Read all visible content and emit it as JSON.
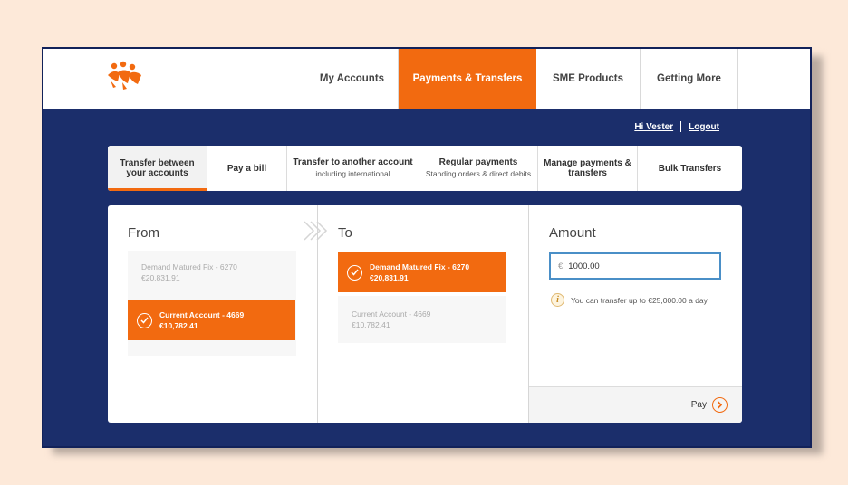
{
  "nav": {
    "items": [
      {
        "label": "My Accounts",
        "active": false
      },
      {
        "label": "Payments & Transfers",
        "active": true
      },
      {
        "label": "SME Products",
        "active": false
      },
      {
        "label": "Getting More",
        "active": false
      }
    ]
  },
  "user": {
    "greeting": "Hi Vester",
    "logout": "Logout"
  },
  "tabs": [
    {
      "title": "Transfer between your accounts",
      "subtitle": "",
      "active": true
    },
    {
      "title": "Pay a bill",
      "subtitle": "",
      "active": false
    },
    {
      "title": "Transfer to another account",
      "subtitle": "including international",
      "active": false
    },
    {
      "title": "Regular payments",
      "subtitle": "Standing orders & direct debits",
      "active": false
    },
    {
      "title": "Manage payments & transfers",
      "subtitle": "",
      "active": false
    },
    {
      "title": "Bulk Transfers",
      "subtitle": "",
      "active": false
    }
  ],
  "from": {
    "title": "From",
    "accounts": [
      {
        "name": "Demand Matured Fix - 6270",
        "balance": "€20,831.91",
        "selected": false
      },
      {
        "name": "Current Account - 4669",
        "balance": "€10,782.41",
        "selected": true
      }
    ]
  },
  "to": {
    "title": "To",
    "accounts": [
      {
        "name": "Demand Matured Fix - 6270",
        "balance": "€20,831.91",
        "selected": true
      },
      {
        "name": "Current Account - 4669",
        "balance": "€10,782.41",
        "selected": false
      }
    ]
  },
  "amount": {
    "title": "Amount",
    "currency": "€",
    "value": "1000.00",
    "info_text": "You can transfer up to €25,000.00 a day"
  },
  "pay_label": "Pay",
  "colors": {
    "accent": "#f26a10",
    "navy": "#1b2e6b",
    "input_border": "#4a8fc7"
  },
  "icons": [
    "logo-icon",
    "check-circle-icon",
    "chevron-right-icon",
    "info-icon",
    "arrow-right-circle-icon"
  ]
}
